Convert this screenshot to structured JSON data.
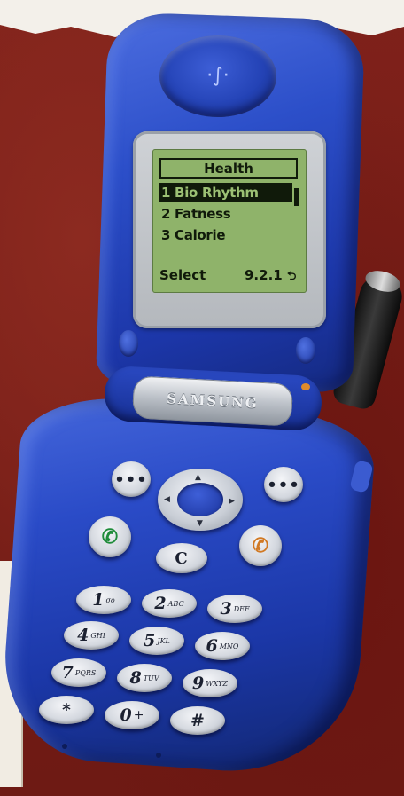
{
  "screen": {
    "title": "Health",
    "items": [
      {
        "label": "1 Bio Rhythm",
        "selected": true
      },
      {
        "label": "2 Fatness",
        "selected": false
      },
      {
        "label": "3 Calorie",
        "selected": false
      }
    ],
    "softkey_left": "Select",
    "menu_index": "9.2.1",
    "back_icon": "return-arrow-icon"
  },
  "brand": "SAMSUNG",
  "keys": {
    "soft_left": "•••",
    "soft_right": "•••",
    "clear": "C",
    "call_icon": "call-icon",
    "end_icon": "end-power-icon",
    "keypad": [
      {
        "num": "1",
        "sub": "σο"
      },
      {
        "num": "2",
        "sub": "ABC"
      },
      {
        "num": "3",
        "sub": "DEF"
      },
      {
        "num": "4",
        "sub": "GHI"
      },
      {
        "num": "5",
        "sub": "JKL"
      },
      {
        "num": "6",
        "sub": "MNO"
      },
      {
        "num": "7",
        "sub": "PQRS"
      },
      {
        "num": "8",
        "sub": "TUV"
      },
      {
        "num": "9",
        "sub": "WXYZ"
      },
      {
        "num": "*",
        "sub": ""
      },
      {
        "num": "0",
        "sub": "+"
      },
      {
        "num": "#",
        "sub": ""
      }
    ]
  },
  "colors": {
    "body_blue": "#2a4bc7",
    "lcd_green": "#8fb36a",
    "background_red": "#7a1c16"
  }
}
